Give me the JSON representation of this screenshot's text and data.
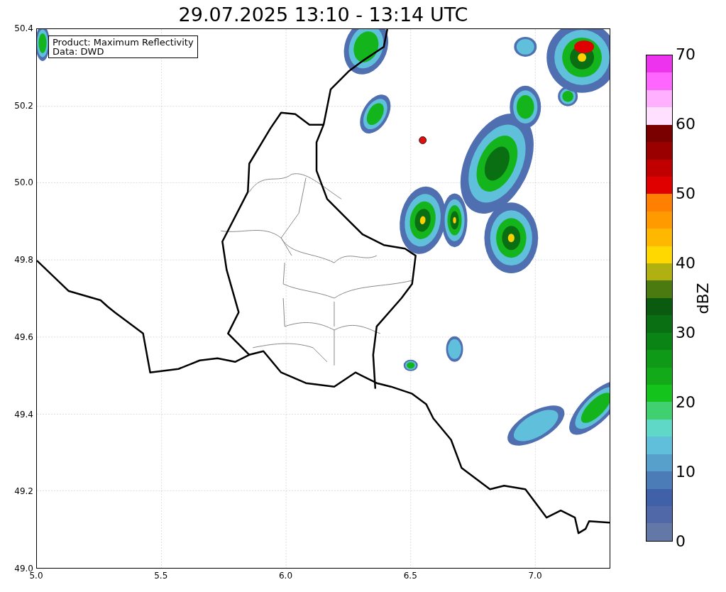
{
  "title": "29.07.2025 13:10 - 13:14 UTC",
  "map": {
    "legend": [
      "Product: Maximum Reflectivity",
      "Data: DWD"
    ],
    "x_ticks": [
      "5.0",
      "5.5",
      "6.0",
      "6.5",
      "7.0"
    ],
    "y_ticks": [
      "50.4",
      "50.2",
      "50.0",
      "49.8",
      "49.6",
      "49.4",
      "49.2",
      "49.0"
    ]
  },
  "colorbar": {
    "label": "dBZ",
    "ticks": [
      "70",
      "60",
      "50",
      "40",
      "30",
      "20",
      "10",
      "0"
    ],
    "segments": [
      {
        "color": "#ee33ee"
      },
      {
        "color": "#ff66ff"
      },
      {
        "color": "#ffb0ff"
      },
      {
        "color": "#ffe0ff"
      },
      {
        "color": "#7a0000"
      },
      {
        "color": "#9a0000"
      },
      {
        "color": "#c00000"
      },
      {
        "color": "#e00000"
      },
      {
        "color": "#ff7f00"
      },
      {
        "color": "#ff9a00"
      },
      {
        "color": "#ffb800"
      },
      {
        "color": "#ffd800"
      },
      {
        "color": "#b0b010"
      },
      {
        "color": "#4a7a10"
      },
      {
        "color": "#0a5a10"
      },
      {
        "color": "#0a6e12"
      },
      {
        "color": "#0a8414"
      },
      {
        "color": "#0e9a16"
      },
      {
        "color": "#12aa18"
      },
      {
        "color": "#14c41c"
      },
      {
        "color": "#40d070"
      },
      {
        "color": "#60d8c8"
      },
      {
        "color": "#60c0dc"
      },
      {
        "color": "#58a0cc"
      },
      {
        "color": "#4c7cb8"
      },
      {
        "color": "#4060a8"
      },
      {
        "color": "#5068a8"
      },
      {
        "color": "#6478a8"
      }
    ]
  }
}
